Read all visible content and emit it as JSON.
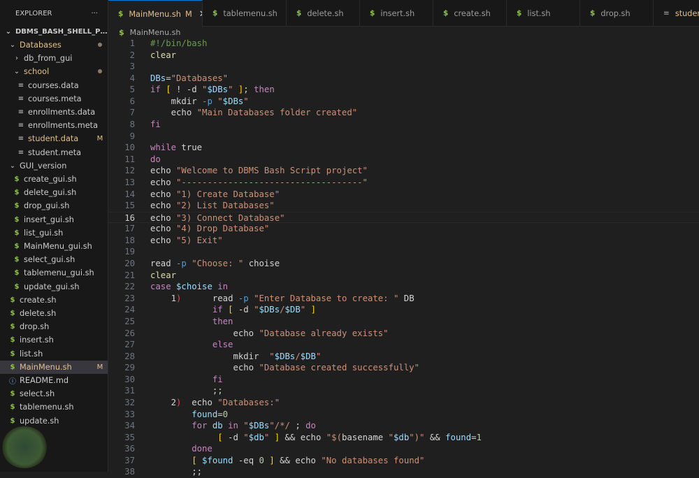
{
  "explorer": {
    "title": "EXPLORER",
    "more": "···",
    "project": "DBMS_BASH_SHELL_PROJ...",
    "items": [
      {
        "label": "Databases",
        "depth": 1,
        "icon": "chevron-down",
        "color": "yellow",
        "badge": "dot"
      },
      {
        "label": "db_from_gui",
        "depth": 2,
        "icon": "chevron-right",
        "color": "plain"
      },
      {
        "label": "school",
        "depth": 2,
        "icon": "chevron-down",
        "color": "yellow",
        "badge": "dot"
      },
      {
        "label": "courses.data",
        "depth": 3,
        "icon": "file-lines",
        "color": "plain"
      },
      {
        "label": "courses.meta",
        "depth": 3,
        "icon": "file-lines",
        "color": "plain"
      },
      {
        "label": "enrollments.data",
        "depth": 3,
        "icon": "file-lines",
        "color": "plain"
      },
      {
        "label": "enrollments.meta",
        "depth": 3,
        "icon": "file-lines",
        "color": "plain"
      },
      {
        "label": "student.data",
        "depth": 3,
        "icon": "file-lines",
        "color": "yellow",
        "badge": "M"
      },
      {
        "label": "student.meta",
        "depth": 3,
        "icon": "file-lines",
        "color": "plain"
      },
      {
        "label": "GUI_version",
        "depth": 1,
        "icon": "chevron-down",
        "color": "plain"
      },
      {
        "label": "create_gui.sh",
        "depth": 2,
        "icon": "shell",
        "color": "plain"
      },
      {
        "label": "delete_gui.sh",
        "depth": 2,
        "icon": "shell",
        "color": "plain"
      },
      {
        "label": "drop_gui.sh",
        "depth": 2,
        "icon": "shell",
        "color": "plain"
      },
      {
        "label": "insert_gui.sh",
        "depth": 2,
        "icon": "shell",
        "color": "plain"
      },
      {
        "label": "list_gui.sh",
        "depth": 2,
        "icon": "shell",
        "color": "plain"
      },
      {
        "label": "MainMenu_gui.sh",
        "depth": 2,
        "icon": "shell",
        "color": "plain"
      },
      {
        "label": "select_gui.sh",
        "depth": 2,
        "icon": "shell",
        "color": "plain"
      },
      {
        "label": "tablemenu_gui.sh",
        "depth": 2,
        "icon": "shell",
        "color": "plain"
      },
      {
        "label": "update_gui.sh",
        "depth": 2,
        "icon": "shell",
        "color": "plain"
      },
      {
        "label": "create.sh",
        "depth": 1,
        "icon": "shell",
        "color": "plain"
      },
      {
        "label": "delete.sh",
        "depth": 1,
        "icon": "shell",
        "color": "plain"
      },
      {
        "label": "drop.sh",
        "depth": 1,
        "icon": "shell",
        "color": "plain"
      },
      {
        "label": "insert.sh",
        "depth": 1,
        "icon": "shell",
        "color": "plain"
      },
      {
        "label": "list.sh",
        "depth": 1,
        "icon": "shell",
        "color": "plain"
      },
      {
        "label": "MainMenu.sh",
        "depth": 1,
        "icon": "shell",
        "color": "yellow",
        "badge": "M",
        "selected": true
      },
      {
        "label": "README.md",
        "depth": 1,
        "icon": "info",
        "color": "plain"
      },
      {
        "label": "select.sh",
        "depth": 1,
        "icon": "shell",
        "color": "plain"
      },
      {
        "label": "tablemenu.sh",
        "depth": 1,
        "icon": "shell",
        "color": "plain"
      },
      {
        "label": "update.sh",
        "depth": 1,
        "icon": "shell",
        "color": "plain"
      }
    ]
  },
  "tabs": [
    {
      "label": "MainMenu.sh",
      "icon": "shell",
      "active": true,
      "badge": "M",
      "close": "✕"
    },
    {
      "label": "tablemenu.sh",
      "icon": "shell"
    },
    {
      "label": "delete.sh",
      "icon": "shell"
    },
    {
      "label": "insert.sh",
      "icon": "shell"
    },
    {
      "label": "create.sh",
      "icon": "shell"
    },
    {
      "label": "list.sh",
      "icon": "shell"
    },
    {
      "label": "drop.sh",
      "icon": "shell"
    },
    {
      "label": "student.data",
      "icon": "file-lines",
      "modified": true
    }
  ],
  "breadcrumb": {
    "icon": "shell",
    "file": "MainMenu.sh"
  },
  "editor": {
    "current_line": 16,
    "lines": [
      [
        [
          "#!/bin/bash",
          "c"
        ]
      ],
      [
        [
          "clear",
          "f"
        ]
      ],
      [],
      [
        [
          "DBs",
          "v"
        ],
        [
          "=",
          "p"
        ],
        [
          "\"Databases\"",
          "s"
        ]
      ],
      [
        [
          "if ",
          "k"
        ],
        [
          "[",
          "y"
        ],
        [
          " ! -d ",
          "p"
        ],
        [
          "\"",
          "s"
        ],
        [
          "$DBs",
          "v"
        ],
        [
          "\" ",
          "s"
        ],
        [
          "]",
          "y"
        ],
        [
          "; ",
          "p"
        ],
        [
          "then",
          "k"
        ]
      ],
      [
        [
          "    mkdir ",
          "p"
        ],
        [
          "-p ",
          "o"
        ],
        [
          "\"",
          "s"
        ],
        [
          "$DBs",
          "v"
        ],
        [
          "\"",
          "s"
        ]
      ],
      [
        [
          "    echo ",
          "p"
        ],
        [
          "\"Main Databases folder created\"",
          "s"
        ]
      ],
      [
        [
          "fi",
          "k"
        ]
      ],
      [],
      [
        [
          "while ",
          "k"
        ],
        [
          "true",
          "p"
        ]
      ],
      [
        [
          "do",
          "k"
        ]
      ],
      [
        [
          "echo ",
          "p"
        ],
        [
          "\"Welcome to DBMS Bash Script project\"",
          "s"
        ]
      ],
      [
        [
          "echo ",
          "p"
        ],
        [
          "\"-----------------------------------\"",
          "s"
        ]
      ],
      [
        [
          "echo ",
          "p"
        ],
        [
          "\"1) Create Database\"",
          "s"
        ]
      ],
      [
        [
          "echo ",
          "p"
        ],
        [
          "\"2) List Databases\"",
          "s"
        ]
      ],
      [
        [
          "echo ",
          "p"
        ],
        [
          "\"3) Connect Database\"",
          "s"
        ]
      ],
      [
        [
          "echo ",
          "p"
        ],
        [
          "\"4) Drop Database\"",
          "s"
        ]
      ],
      [
        [
          "echo ",
          "p"
        ],
        [
          "\"5) Exit\"",
          "s"
        ]
      ],
      [],
      [
        [
          "read ",
          "p"
        ],
        [
          "-p ",
          "o"
        ],
        [
          "\"Choose: \"",
          "s"
        ],
        [
          " choise",
          "p"
        ]
      ],
      [
        [
          "clear",
          "f"
        ]
      ],
      [
        [
          "case ",
          "k"
        ],
        [
          "$choise",
          "v"
        ],
        [
          " in",
          "k"
        ]
      ],
      [
        [
          "    1",
          "p"
        ],
        [
          ")",
          "r"
        ],
        [
          "      read ",
          "p"
        ],
        [
          "-p ",
          "o"
        ],
        [
          "\"Enter Database to create: \"",
          "s"
        ],
        [
          " DB",
          "p"
        ]
      ],
      [
        [
          "            if ",
          "k"
        ],
        [
          "[",
          "y"
        ],
        [
          " -d ",
          "p"
        ],
        [
          "\"",
          "s"
        ],
        [
          "$DBs",
          "v"
        ],
        [
          "/",
          "s"
        ],
        [
          "$DB",
          "v"
        ],
        [
          "\" ",
          "s"
        ],
        [
          "]",
          "y"
        ]
      ],
      [
        [
          "            then",
          "k"
        ]
      ],
      [
        [
          "                echo ",
          "p"
        ],
        [
          "\"Database already exists\"",
          "s"
        ]
      ],
      [
        [
          "            else",
          "k"
        ]
      ],
      [
        [
          "                mkdir  ",
          "p"
        ],
        [
          "\"",
          "s"
        ],
        [
          "$DBs",
          "v"
        ],
        [
          "/",
          "s"
        ],
        [
          "$DB",
          "v"
        ],
        [
          "\"",
          "s"
        ]
      ],
      [
        [
          "                echo ",
          "p"
        ],
        [
          "\"Database created successfully\"",
          "s"
        ]
      ],
      [
        [
          "            fi",
          "k"
        ]
      ],
      [
        [
          "            ;;",
          "p"
        ]
      ],
      [
        [
          "    2",
          "p"
        ],
        [
          ")",
          "r"
        ],
        [
          "  echo ",
          "p"
        ],
        [
          "\"Databases:\"",
          "s"
        ]
      ],
      [
        [
          "        found",
          "v"
        ],
        [
          "=",
          "p"
        ],
        [
          "0",
          "n"
        ]
      ],
      [
        [
          "        for ",
          "k"
        ],
        [
          "db ",
          "v"
        ],
        [
          "in ",
          "k"
        ],
        [
          "\"",
          "s"
        ],
        [
          "$DBs",
          "v"
        ],
        [
          "\"/*/",
          "s"
        ],
        [
          " ; ",
          "p"
        ],
        [
          "do",
          "k"
        ]
      ],
      [
        [
          "             [",
          "y"
        ],
        [
          " -d ",
          "p"
        ],
        [
          "\"",
          "s"
        ],
        [
          "$db",
          "v"
        ],
        [
          "\" ",
          "s"
        ],
        [
          "]",
          "y"
        ],
        [
          " && echo ",
          "p"
        ],
        [
          "\"$(",
          "s"
        ],
        [
          "basename ",
          "p"
        ],
        [
          "\"",
          "s"
        ],
        [
          "$db",
          "v"
        ],
        [
          "\")\"",
          "s"
        ],
        [
          " && ",
          "p"
        ],
        [
          "found",
          "v"
        ],
        [
          "=",
          "p"
        ],
        [
          "1",
          "n"
        ]
      ],
      [
        [
          "        done",
          "k"
        ]
      ],
      [
        [
          "        [",
          "y"
        ],
        [
          " $found",
          "v"
        ],
        [
          " -eq ",
          "p"
        ],
        [
          "0 ",
          "n"
        ],
        [
          "]",
          "y"
        ],
        [
          " && echo ",
          "p"
        ],
        [
          "\"No databases found\"",
          "s"
        ]
      ],
      [
        [
          "        ;;",
          "p"
        ]
      ]
    ]
  }
}
